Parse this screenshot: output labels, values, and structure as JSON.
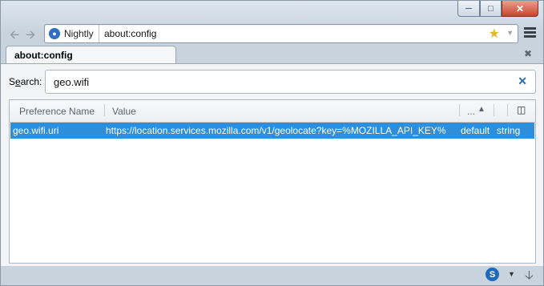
{
  "toolbar": {
    "identity_label": "Nightly",
    "url": "about:config"
  },
  "tab": {
    "title": "about:config"
  },
  "search": {
    "label_prefix": "S",
    "label_access": "e",
    "label_rest": "arch:",
    "value": "geo.wifi"
  },
  "columns": {
    "name": "Preference Name",
    "value": "Value",
    "status": "..."
  },
  "rows": [
    {
      "name": "geo.wifi.uri",
      "value": "https://location.services.mozilla.com/v1/geolocate?key=%MOZILLA_API_KEY%",
      "status": "default",
      "type": "string"
    }
  ],
  "icons": {
    "back": "back-arrow-icon",
    "forward": "forward-arrow-icon",
    "globe": "globe-icon",
    "bookmark": "star-icon",
    "menu": "hamburger-menu-icon",
    "clear": "close-icon",
    "sort": "sort-ascending-icon",
    "column_picker": "column-picker-icon",
    "sync": "sync-s-icon",
    "downloads": "download-arrow-icon"
  },
  "colors": {
    "selection": "#2e8ed9",
    "close_button": "#c8452f"
  }
}
